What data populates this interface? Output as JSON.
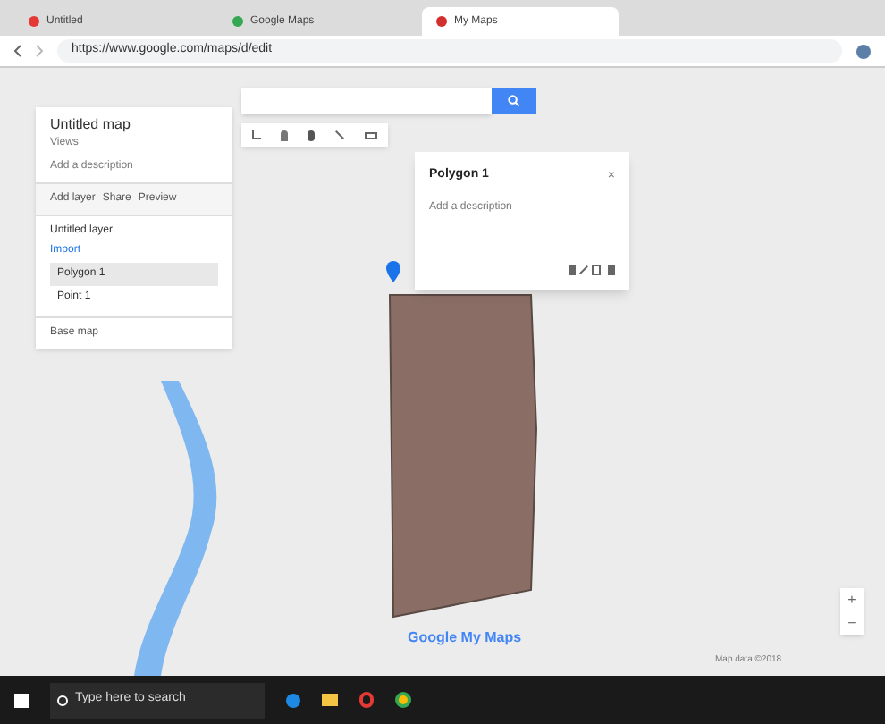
{
  "browser": {
    "tabs": [
      {
        "title": "Untitled",
        "selected": false,
        "color": "#e53935"
      },
      {
        "title": "Google Maps",
        "selected": false,
        "color": "#34a853"
      },
      {
        "title": "My Maps",
        "selected": true,
        "color": "#d32f2f"
      }
    ],
    "url": "https://www.google.com/maps/d/edit"
  },
  "sidebar": {
    "title": "Untitled map",
    "subtitle": "Views",
    "description": "Add a description",
    "actions": [
      "Add layer",
      "Share",
      "Preview"
    ],
    "layer": {
      "title": "Untitled layer",
      "import": "Import",
      "items": [
        {
          "label": "Polygon 1",
          "selected": true
        },
        {
          "label": "Point 1",
          "selected": false
        }
      ]
    },
    "base_map": "Base map"
  },
  "popup": {
    "title": "Polygon 1",
    "description": "Add a description",
    "close": "×"
  },
  "map": {
    "logo": "Google My Maps",
    "zoom_in": "+",
    "zoom_out": "−",
    "copyright": "Map data ©2018"
  },
  "taskbar": {
    "search": "Type here to search"
  }
}
